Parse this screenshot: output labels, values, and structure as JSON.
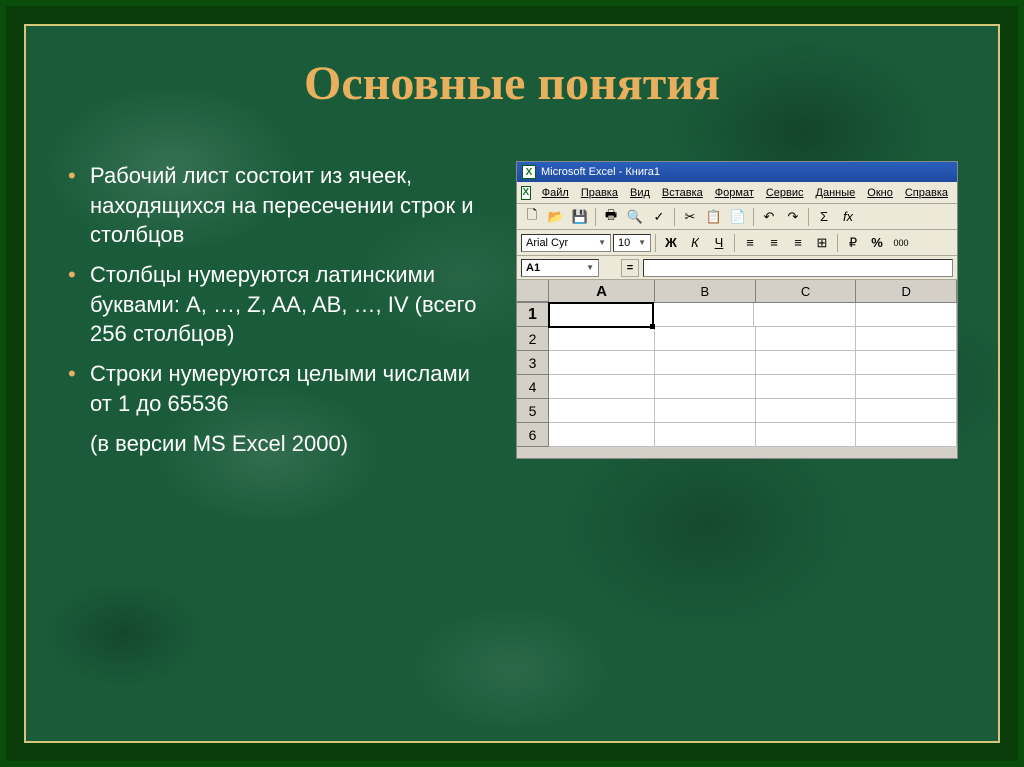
{
  "slide": {
    "title": "Основные понятия",
    "bullets": [
      "Рабочий лист состоит из ячеек, находящихся на пересечении строк и столбцов",
      "Столбцы нумеруются латинскими буквами: A, …, Z, AA, AB, …, IV (всего 256 столбцов)",
      "Строки нумеруются целыми числами от 1 до 65536"
    ],
    "sub_note": "(в версии MS Excel 2000)"
  },
  "excel": {
    "title": "Microsoft Excel - Книга1",
    "icon_text": "X",
    "menu": [
      "Файл",
      "Правка",
      "Вид",
      "Вставка",
      "Формат",
      "Сервис",
      "Данные",
      "Окно",
      "Справка"
    ],
    "toolbar1": {
      "new": "🗋",
      "open": "📂",
      "save": "💾",
      "print": "🖶",
      "preview": "🔍",
      "spell": "✓",
      "cut": "✂",
      "copy": "📋",
      "paste": "📄",
      "undo": "↶",
      "redo": "↷",
      "autosum": "Σ",
      "fx": "fx"
    },
    "toolbar2": {
      "font_name": "Arial Cyr",
      "font_size": "10",
      "bold": "Ж",
      "italic": "К",
      "underline": "Ч",
      "align_l": "≡",
      "align_c": "≡",
      "align_r": "≡",
      "merge": "⊞",
      "currency": "₽",
      "percent": "%",
      "thousands": "000"
    },
    "namebox": "A1",
    "equals": "=",
    "columns": [
      "A",
      "B",
      "C",
      "D"
    ],
    "rows": [
      "1",
      "2",
      "3",
      "4",
      "5",
      "6"
    ]
  }
}
